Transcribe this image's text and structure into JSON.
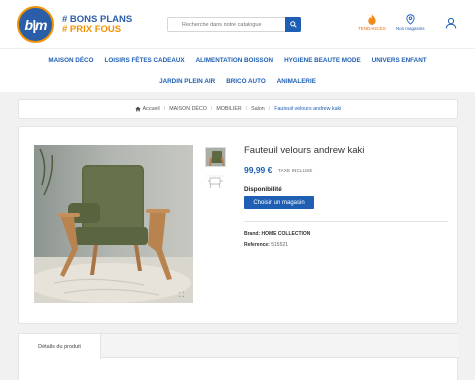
{
  "brand": {
    "logo_text": "b|m",
    "slogan_line1": "# BONS PLANS",
    "slogan_line2": "# PRIX FOUS"
  },
  "search": {
    "placeholder": "Recherche dans notre catalogue"
  },
  "header_icons": {
    "tendances": "TENDANCES",
    "stores": "Nos magasins"
  },
  "nav": {
    "row1": [
      "MAISON DÉCO",
      "LOISIRS FÊTES CADEAUX",
      "ALIMENTATION BOISSON",
      "HYGIENE BEAUTE MODE",
      "Univers Enfant"
    ],
    "row2": [
      "JARDIN PLEIN AIR",
      "BRICO AUTO",
      "ANIMALERIE"
    ]
  },
  "breadcrumb": [
    "Accueil",
    "MAISON DÉCO",
    "MOBILIER",
    "Salon",
    "Fauteuil velours andrew kaki"
  ],
  "product": {
    "title": "Fauteuil velours andrew kaki",
    "price": "99,99 €",
    "tax_note": "TAXE INCLUSE",
    "availability_label": "Disponibilité",
    "store_button": "Choisir un magasin",
    "brand_label": "Brand:",
    "brand_value": "HOME COLLECTION",
    "reference_label": "Reference:",
    "reference_value": "515521"
  },
  "tabs": {
    "details": "Détails du produit"
  },
  "colors": {
    "brand_blue": "#1e5fb4",
    "brand_orange": "#f39200",
    "chair_green": "#5f6a45",
    "wood": "#b9834f"
  }
}
